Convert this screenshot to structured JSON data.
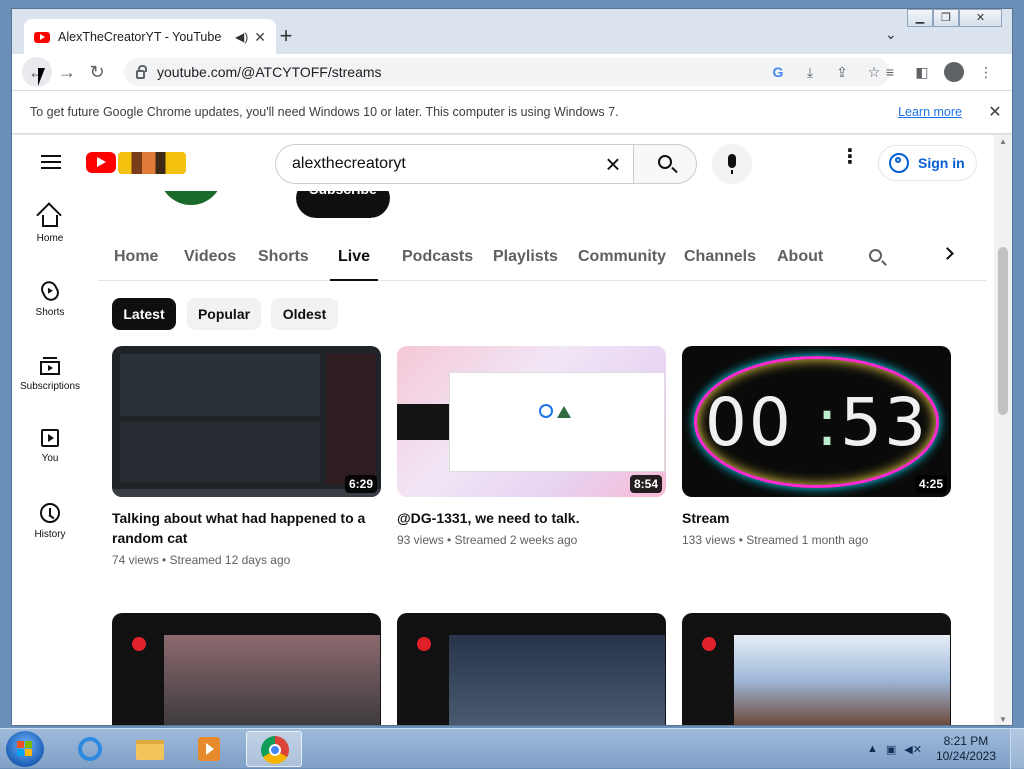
{
  "browser": {
    "tab_title": "AlexTheCreatorYT - YouTube",
    "tab_audio_icon": "speaker-icon",
    "new_tab_label": "+",
    "url": "youtube.com/@ATCYTOFF/streams",
    "infobar": {
      "text": "To get future Google Chrome updates, you'll need Windows 10 or later. This computer is using Windows 7.",
      "link": "Learn more"
    }
  },
  "masthead": {
    "search_value": "alexthecreatoryt",
    "signin_label": "Sign in"
  },
  "channel": {
    "subscribe_label": "Subscribe"
  },
  "left_nav": [
    {
      "label": "Home",
      "icon": "home-icon"
    },
    {
      "label": "Shorts",
      "icon": "shorts-icon"
    },
    {
      "label": "Subscriptions",
      "icon": "subscriptions-icon"
    },
    {
      "label": "You",
      "icon": "you-icon"
    },
    {
      "label": "History",
      "icon": "history-icon"
    }
  ],
  "channel_tabs": [
    "Home",
    "Videos",
    "Shorts",
    "Live",
    "Podcasts",
    "Playlists",
    "Community",
    "Channels",
    "About"
  ],
  "active_tab": "Live",
  "chips": [
    "Latest",
    "Popular",
    "Oldest"
  ],
  "active_chip": "Latest",
  "videos": [
    {
      "title": "Talking about what had happened to a random cat",
      "meta": "74 views • Streamed 12 days ago",
      "duration": "6:29"
    },
    {
      "title": "@DG-1331, we need to talk.",
      "meta": "93 views • Streamed 2 weeks ago",
      "duration": "8:54"
    },
    {
      "title": "Stream",
      "meta": "133 views • Streamed 1 month ago",
      "duration": "4:25",
      "timer_text": "00",
      "timer_text2": "53"
    }
  ],
  "taskbar": {
    "time": "8:21 PM",
    "date": "10/24/2023"
  },
  "colors": {
    "youtube_red": "#ff0000",
    "link_blue": "#065fd4",
    "chrome_link": "#1a73e8"
  }
}
